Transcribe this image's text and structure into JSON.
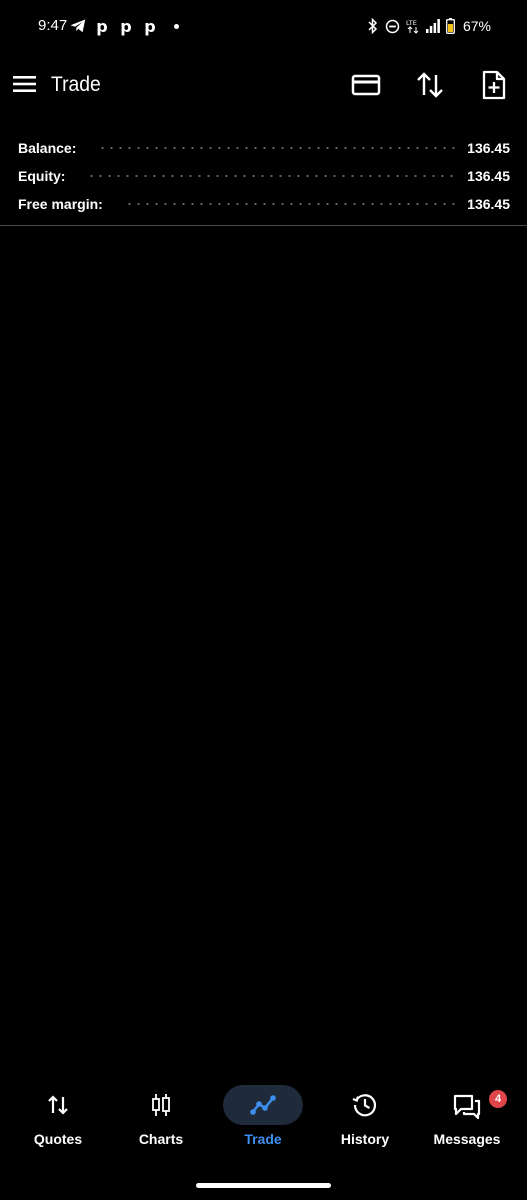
{
  "status_bar": {
    "time": "9:47",
    "left_icons": [
      "telegram-icon",
      "p-app-icon",
      "p-app-icon",
      "p-app-icon",
      "notification-dot"
    ],
    "right_icons": [
      "bluetooth-icon",
      "dnd-icon",
      "lte-icon",
      "signal-icon",
      "battery-icon"
    ],
    "battery": "67%"
  },
  "app_bar": {
    "title": "Trade",
    "actions": [
      "card-icon",
      "sort-icon",
      "new-document-icon"
    ]
  },
  "summary": {
    "balance_label": "Balance:",
    "balance_value": "136.45",
    "equity_label": "Equity:",
    "equity_value": "136.45",
    "free_margin_label": "Free margin:",
    "free_margin_value": "136.45"
  },
  "bottom_nav": {
    "quotes": "Quotes",
    "charts": "Charts",
    "trade": "Trade",
    "history": "History",
    "messages": "Messages",
    "messages_badge": "4",
    "active": "trade"
  },
  "colors": {
    "background": "#000000",
    "accent": "#3d8ef0",
    "active_pill": "#1f2a3a",
    "badge": "#e0454a",
    "dots": "#6b6f8a"
  }
}
